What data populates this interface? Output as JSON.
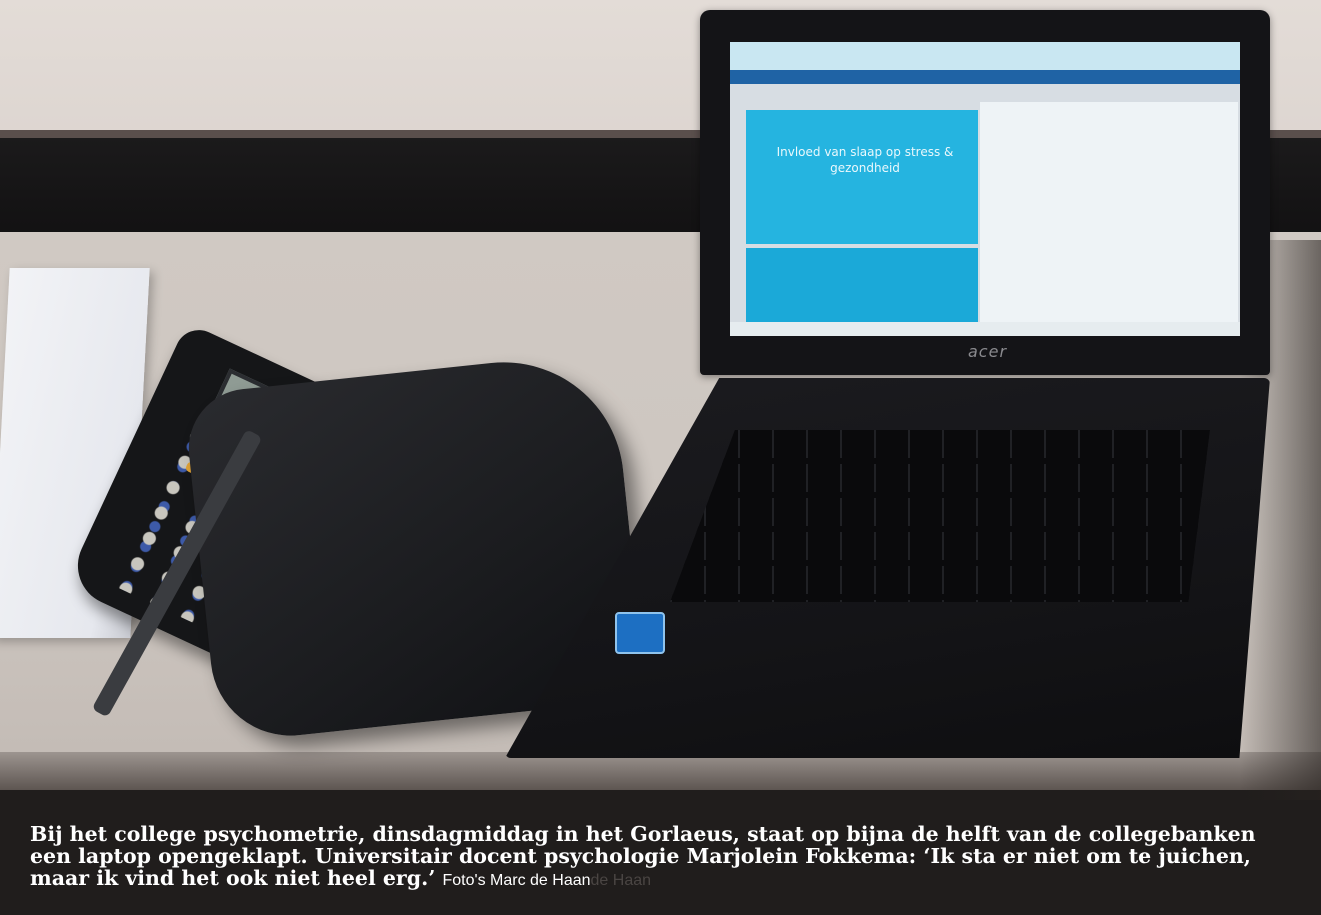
{
  "photo": {
    "laptop_brand": "acer",
    "screen_heading": "Invloed van slaap op stress & gezondheid"
  },
  "caption": {
    "text": "Bij het college psychometrie, dinsdagmiddag in het Gorlaeus, staat op bijna de helft van de collegebanken een laptop opengeklapt. Universitair docent psychologie Marjolein Fokkema: ‘Ik sta er niet om te juichen, maar ik vind het ook niet heel erg.’",
    "credit": "Foto's Marc de Haan",
    "credit_ghost": "de Haan"
  }
}
